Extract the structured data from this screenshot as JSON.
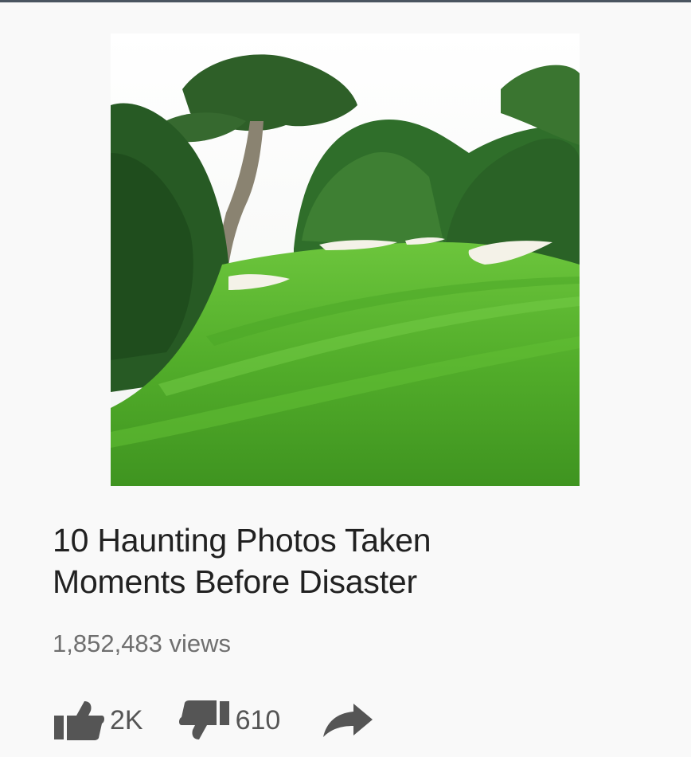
{
  "video": {
    "title_line1": "10 Haunting Photos Taken",
    "title_line2": "Moments Before Disaster",
    "views": "1,852,483 views"
  },
  "actions": {
    "like_count": "2K",
    "dislike_count": "610"
  },
  "icons": {
    "like": "thumbs-up-icon",
    "dislike": "thumbs-down-icon",
    "share": "share-arrow-icon"
  },
  "colors": {
    "title": "#212121",
    "meta": "#6f6f6f",
    "icon": "#555555",
    "fairway": "#5dbb2f",
    "trees": "#2d6b2a"
  }
}
